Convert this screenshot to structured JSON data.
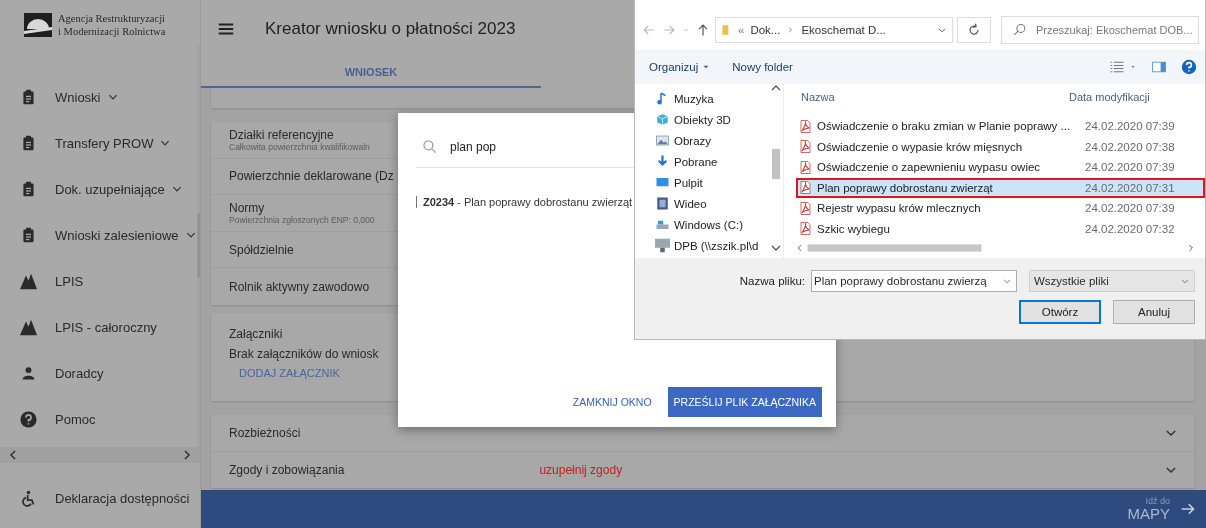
{
  "sidebar": {
    "logo_lines": [
      "Agencja Restrukturyzacji",
      "i Modernizacji Rolnictwa"
    ],
    "items": [
      {
        "label": "Wnioski",
        "kind": "clipboard",
        "expandable": true
      },
      {
        "label": "Transfery PROW",
        "kind": "clipboard",
        "expandable": true
      },
      {
        "label": "Dok. uzupełniające",
        "kind": "clipboard",
        "expandable": true
      },
      {
        "label": "Wnioski zalesieniowe",
        "kind": "clipboard",
        "expandable": true
      },
      {
        "label": "LPIS",
        "kind": "mountains",
        "expandable": false
      },
      {
        "label": "LPIS - całoroczny",
        "kind": "mountains",
        "expandable": false
      },
      {
        "label": "Doradcy",
        "kind": "person",
        "expandable": false
      },
      {
        "label": "Pomoc",
        "kind": "help",
        "expandable": false
      }
    ],
    "footer_item": {
      "label": "Deklaracja dostępności"
    }
  },
  "header": {
    "title": "Kreator wniosku o płatności 2023"
  },
  "tabs": [
    {
      "label": "WNIOSEK",
      "selected": true
    }
  ],
  "cards": [
    {
      "kind": "stub"
    },
    {
      "kind": "rows",
      "rows": [
        {
          "title": "Działki referencyjne",
          "subtitle": "Całkowita powierzchnia kwalifikowaln"
        },
        {
          "title": "Powierzchnie deklarowane (Dz"
        },
        {
          "title": "Normy",
          "subtitle": "Powierzchnia zgłoszonych ENP: 0,000"
        },
        {
          "title": "Spółdzielnie"
        },
        {
          "title": "Rolnik aktywny zawodowo"
        }
      ]
    },
    {
      "kind": "attachments",
      "title": "Załączniki",
      "text": "Brak załączników do wniosk",
      "action": "DODAJ ZAŁĄCZNIK"
    },
    {
      "kind": "rows",
      "rows": [
        {
          "title": "Rozbieżności",
          "expandable": true
        },
        {
          "title": "Zgody i zobowiązania",
          "status": "uzupełnij zgody",
          "expandable": true
        }
      ]
    }
  ],
  "bottom_bar": {
    "hint": "Idź do",
    "label": "MAPY"
  },
  "modal": {
    "search": {
      "value": "plan pop"
    },
    "results": [
      {
        "text": "**Z0234** - Plan poprawy dobrostanu zwierząt"
      }
    ],
    "buttons": [
      {
        "label": "ZAMKNIJ OKNO",
        "kind": "text"
      },
      {
        "label": "PRZEŚLIJ PLIK ZAŁĄCZNIKA",
        "kind": "primary"
      }
    ]
  },
  "file_dialog": {
    "breadcrumb_overflow": "«",
    "breadcrumb": [
      "Dok...",
      "Ekoschemat D..."
    ],
    "search": {
      "placeholder": "Przeszukaj: Ekoschemat DOB..."
    },
    "toolbar": [
      "Organizuj",
      "Nowy folder"
    ],
    "tree": [
      {
        "label": "Muzyka",
        "kind": "music"
      },
      {
        "label": "Obiekty 3D",
        "kind": "cube"
      },
      {
        "label": "Obrazy",
        "kind": "picture"
      },
      {
        "label": "Pobrane",
        "kind": "download"
      },
      {
        "label": "Pulpit",
        "kind": "desktop"
      },
      {
        "label": "Wideo",
        "kind": "film"
      },
      {
        "label": "Windows (C:)",
        "kind": "drive"
      },
      {
        "label": "DPB (\\\\zszik.pl\\d",
        "kind": "netdrive"
      }
    ],
    "columns": [
      "Nazwa",
      "Data modyfikacji"
    ],
    "files": [
      {
        "name": "Oświadczenie o braku zmian w Planie poprawy ...",
        "date": "24.02.2020 07:39",
        "selected": false,
        "highlighted": false
      },
      {
        "name": "Oświadczenie o wypasie krów mięsnych",
        "date": "24.02.2020 07:38",
        "selected": false,
        "highlighted": false
      },
      {
        "name": "Oświadczenie o zapewnieniu wypasu owiec",
        "date": "24.02.2020 07:39",
        "selected": false,
        "highlighted": false
      },
      {
        "name": "Plan poprawy dobrostanu zwierząt",
        "date": "24.02.2020 07:31",
        "selected": true,
        "highlighted": true
      },
      {
        "name": "Rejestr wypasu krów mlecznych",
        "date": "24.02.2020 07:39",
        "selected": false,
        "highlighted": false
      },
      {
        "name": "Szkic wybiegu",
        "date": "24.02.2020 07:32",
        "selected": false,
        "highlighted": false
      }
    ],
    "file_name": {
      "label": "Nazwa pliku:",
      "value": "Plan poprawy dobrostanu zwierzą"
    },
    "file_type": "Wszystkie pliki",
    "buttons": [
      {
        "label": "Otwórz",
        "kind": "default"
      },
      {
        "label": "Anuluj",
        "kind": "normal"
      }
    ]
  }
}
